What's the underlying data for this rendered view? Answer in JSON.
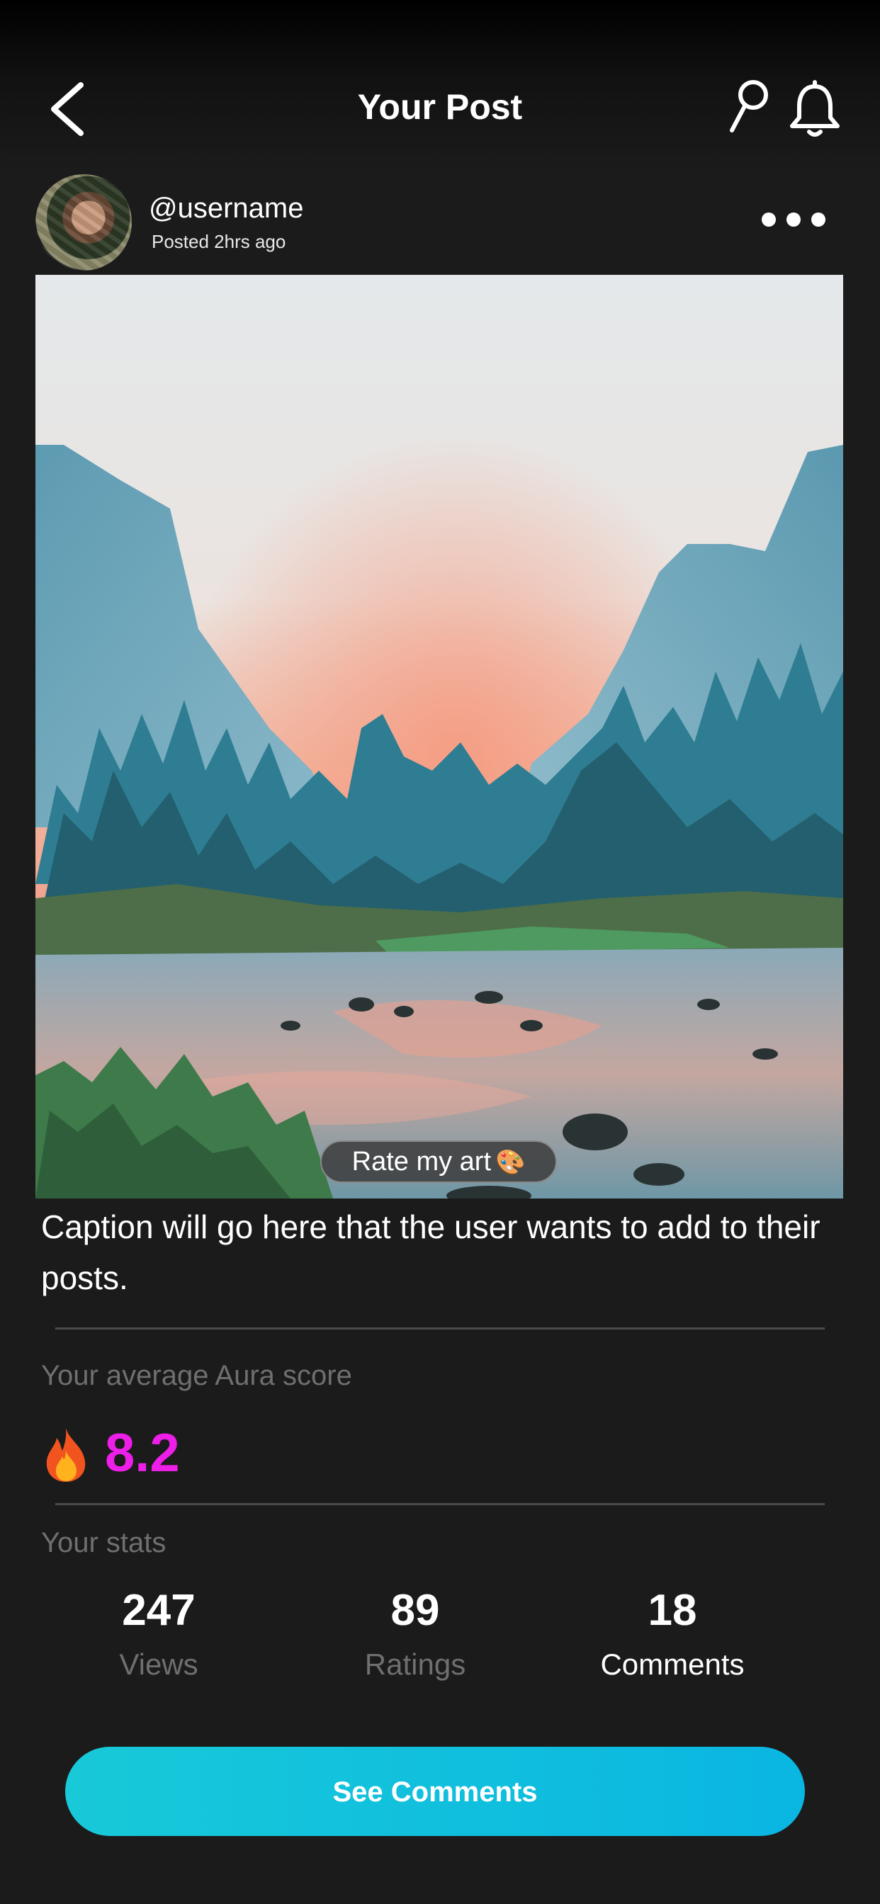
{
  "header": {
    "title": "Your Post",
    "back_icon": "chevron-left-icon",
    "search_icon": "search-icon",
    "bell_icon": "bell-icon"
  },
  "post": {
    "username": "@username",
    "posted": "Posted 2hrs ago",
    "more_icon": "more-horizontal-icon",
    "image_label": "Rate my art",
    "image_label_emoji": "🎨",
    "caption": "Caption will go here that the user wants to add to their posts."
  },
  "aura": {
    "label": "Your average Aura score",
    "icon": "fire-icon",
    "score": "8.2",
    "score_color": "#ee1ee9"
  },
  "stats": {
    "label": "Your stats",
    "items": [
      {
        "value": "247",
        "label": "Views"
      },
      {
        "value": "89",
        "label": "Ratings"
      },
      {
        "value": "18",
        "label": "Comments"
      }
    ]
  },
  "cta": {
    "label": "See Comments",
    "gradient_start": "#18c9d8",
    "gradient_end": "#0ab6e2"
  }
}
